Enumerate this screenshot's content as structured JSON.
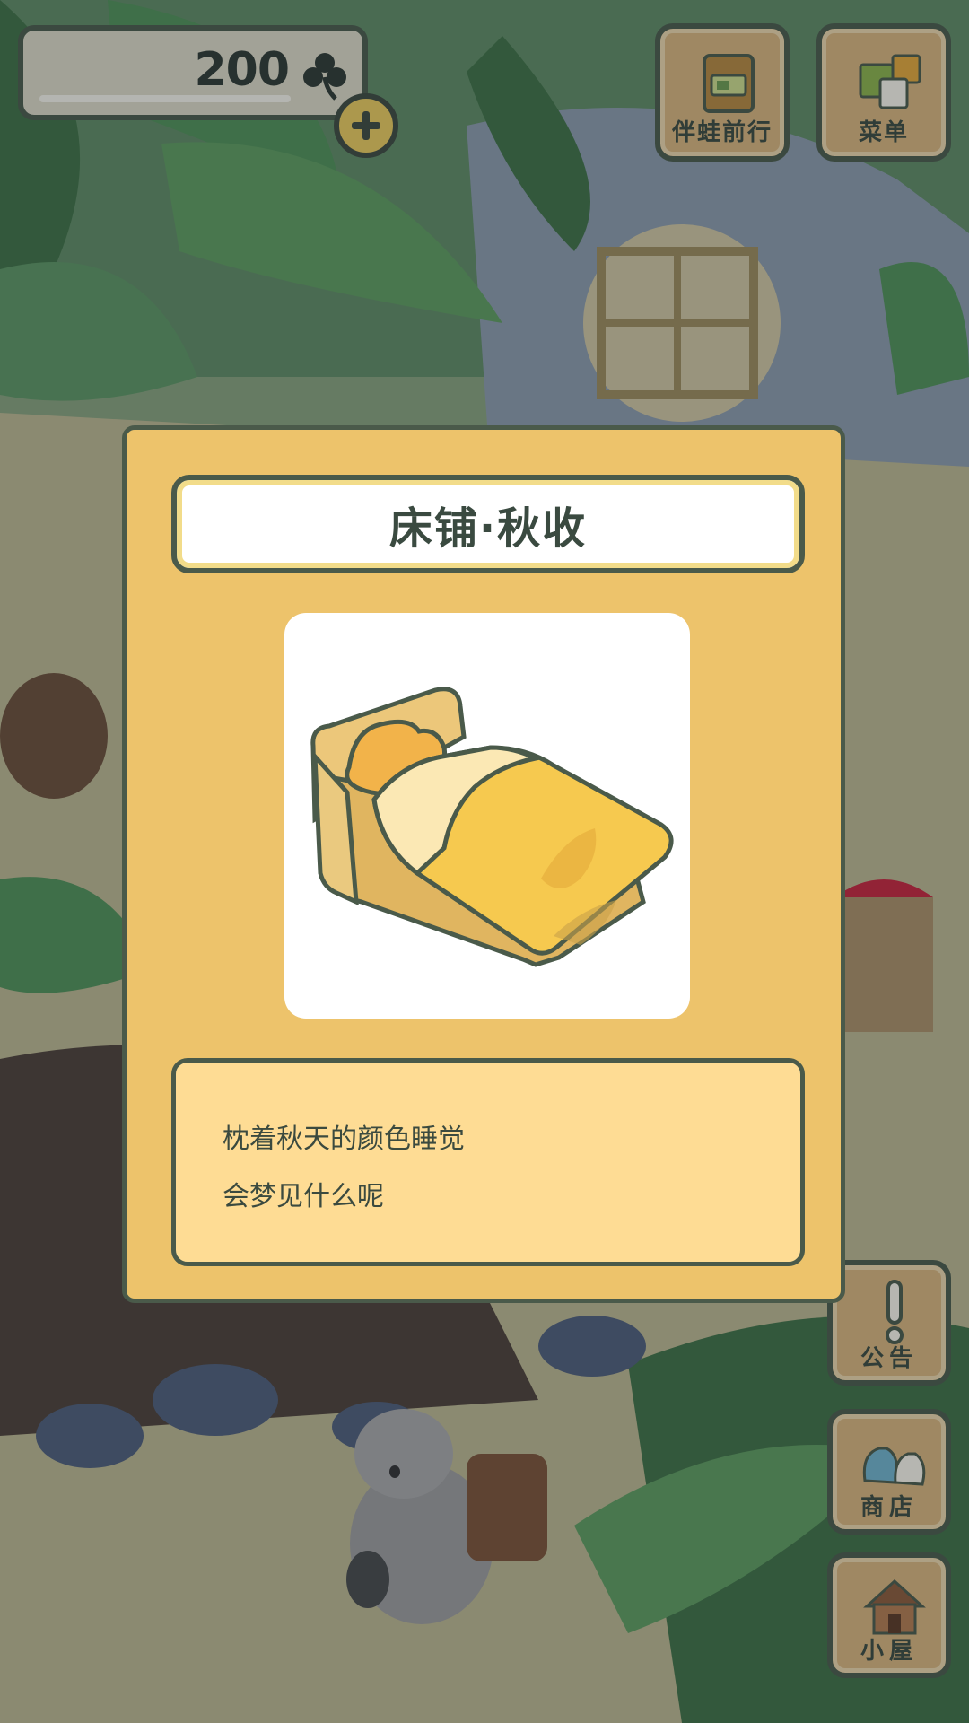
{
  "header": {
    "clover_count": "200",
    "clover_icon": "clover-icon",
    "add_icon": "plus-icon"
  },
  "top_buttons": [
    {
      "label": "伴蛙前行",
      "icon": "journal-icon"
    },
    {
      "label": "菜单",
      "icon": "menu-cards-icon"
    }
  ],
  "side_buttons": [
    {
      "label": "公告",
      "icon": "exclamation-icon"
    },
    {
      "label": "商店",
      "icon": "bags-icon"
    },
    {
      "label": "小屋",
      "icon": "house-icon"
    }
  ],
  "item_panel": {
    "title": "床铺·秋收",
    "image_icon": "autumn-bed-icon",
    "description": [
      "枕着秋天的颜色睡觉",
      "会梦见什么呢"
    ]
  },
  "colors": {
    "panel": "#edc36b",
    "description_bg": "#fedc94",
    "border": "#4a5a4a",
    "button_wood": "#d4b27a"
  }
}
